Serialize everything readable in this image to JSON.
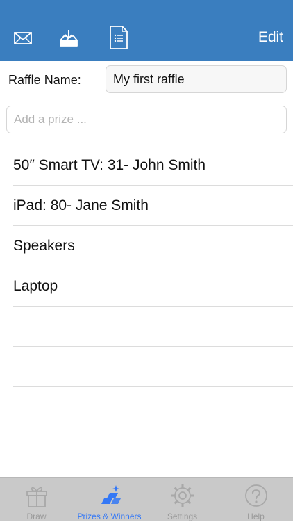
{
  "navbar": {
    "icons": [
      "mail-icon",
      "download-tray-icon",
      "document-list-icon"
    ],
    "edit_label": "Edit",
    "background": "#3a7ebf"
  },
  "raffle": {
    "label": "Raffle Name:",
    "value": "My first raffle"
  },
  "prize_input": {
    "placeholder": "Add a prize ..."
  },
  "prizes": [
    "50″ Smart TV: 31- John Smith",
    "iPad: 80- Jane Smith",
    "Speakers",
    "Laptop",
    "",
    ""
  ],
  "tabbar": {
    "tabs": [
      {
        "label": "Draw",
        "icon": "gift-icon",
        "active": false
      },
      {
        "label": "Prizes & Winners",
        "icon": "prizes-icon",
        "active": true
      },
      {
        "label": "Settings",
        "icon": "gear-icon",
        "active": false
      },
      {
        "label": "Help",
        "icon": "help-icon",
        "active": false
      }
    ],
    "active_color": "#3478f6",
    "inactive_color": "#9a9a9a"
  }
}
